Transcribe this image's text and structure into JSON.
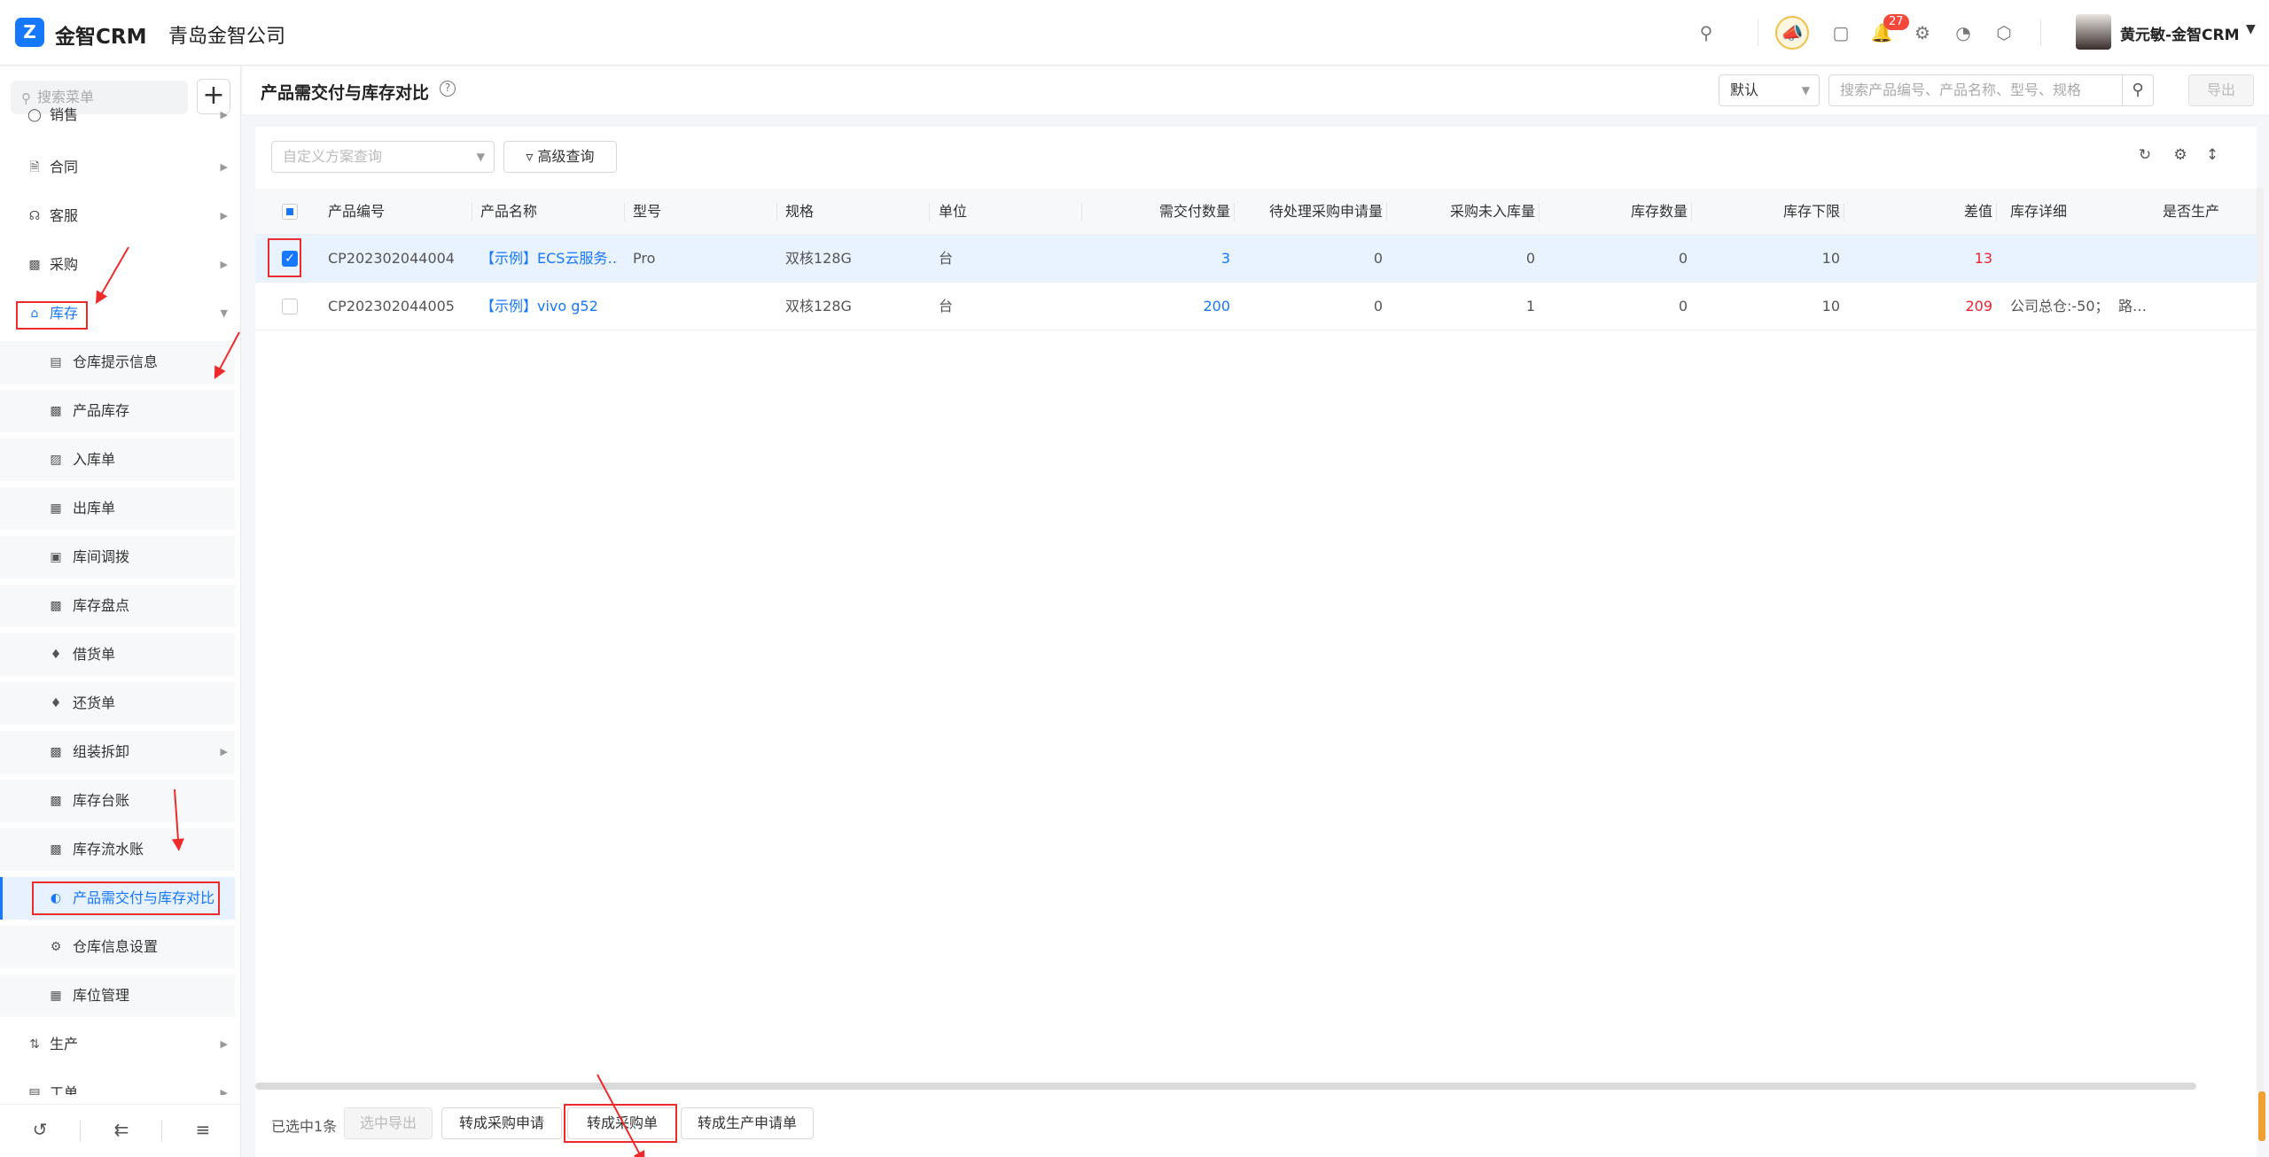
{
  "app": {
    "logo_name": "金智CRM",
    "company": "青岛金智公司"
  },
  "topbar": {
    "notification_count": "27",
    "user_name": "黄元敏-金智CRM",
    "icons": [
      "search-icon",
      "horn-icon",
      "contacts-icon",
      "bell-icon",
      "settings-icon",
      "pie-chart-icon",
      "cube-icon"
    ]
  },
  "sidebar": {
    "search_placeholder": "搜索菜单",
    "items": [
      {
        "label": "销售",
        "icon": "tag"
      },
      {
        "label": "合同",
        "icon": "doc"
      },
      {
        "label": "客服",
        "icon": "headset"
      },
      {
        "label": "采购",
        "icon": "cart"
      },
      {
        "label": "库存",
        "icon": "warehouse"
      },
      {
        "label": "仓库提示信息",
        "icon": "info"
      },
      {
        "label": "产品库存",
        "icon": "file"
      },
      {
        "label": "入库单",
        "icon": "in"
      },
      {
        "label": "出库单",
        "icon": "out"
      },
      {
        "label": "库间调拨",
        "icon": "transfer"
      },
      {
        "label": "库存盘点",
        "icon": "check"
      },
      {
        "label": "借货单",
        "icon": "borrow"
      },
      {
        "label": "还货单",
        "icon": "return"
      },
      {
        "label": "组装拆卸",
        "icon": "assemble"
      },
      {
        "label": "库存台账",
        "icon": "ledger"
      },
      {
        "label": "库存流水账",
        "icon": "flow"
      },
      {
        "label": "产品需交付与库存对比",
        "icon": "compare"
      },
      {
        "label": "仓库信息设置",
        "icon": "settings"
      },
      {
        "label": "库位管理",
        "icon": "grid"
      },
      {
        "label": "生产",
        "icon": "produce"
      },
      {
        "label": "工单",
        "icon": "ticket"
      }
    ]
  },
  "page": {
    "title": "产品需交付与库存对比",
    "default_select": "默认",
    "search_placeholder": "搜索产品编号、产品名称、型号、规格",
    "export_label": "导出",
    "filter_placeholder": "自定义方案查询",
    "advanced_query": "高级查询"
  },
  "table": {
    "columns": [
      "产品编号",
      "产品名称",
      "型号",
      "规格",
      "单位",
      "需交付数量",
      "待处理采购申请量",
      "采购未入库量",
      "库存数量",
      "库存下限",
      "差值",
      "库存详细",
      "是否生产"
    ],
    "rows": [
      {
        "selected": true,
        "code": "CP202302044004",
        "name": "【示例】ECS云服务…",
        "model": "Pro",
        "spec": "双核128G",
        "unit": "台",
        "deliver": "3",
        "pending_purchase": "0",
        "not_stocked": "0",
        "stock": "0",
        "min_stock": "10",
        "diff": "13",
        "detail": "",
        "produce": ""
      },
      {
        "selected": false,
        "code": "CP202302044005",
        "name": "【示例】vivo g52",
        "model": "",
        "spec": "双核128G",
        "unit": "台",
        "deliver": "200",
        "pending_purchase": "0",
        "not_stocked": "1",
        "stock": "0",
        "min_stock": "10",
        "diff": "209",
        "detail": "公司总仓:-50；",
        "produce": "路…"
      }
    ]
  },
  "footer": {
    "selected_text": "已选中1条",
    "btn_export_selected": "选中导出",
    "btn_purchase_request": "转成采购申请",
    "btn_purchase_order": "转成采购单",
    "btn_production_request": "转成生产申请单"
  },
  "colors": {
    "primary": "#1677ff",
    "danger": "#f5222d",
    "annotation": "#ee2b2b"
  }
}
